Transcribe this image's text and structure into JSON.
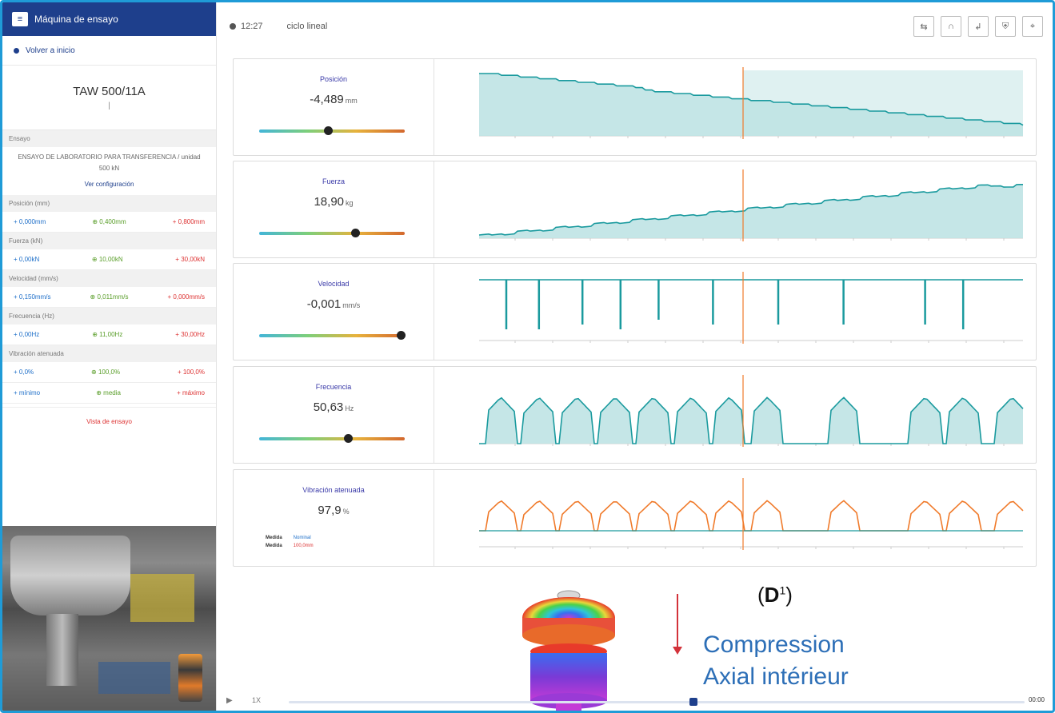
{
  "sidebar": {
    "app_title": "Máquina de ensayo",
    "back_label": "Volver a inicio",
    "machine_name": "TAW 500/11A",
    "machine_sub": "|",
    "test_section": "Ensayo",
    "test_desc": "ENSAYO DE LABORATORIO PARA TRANSFERENCIA / unidad 500 kN",
    "test_link": "Ver configuración",
    "groups": [
      {
        "head": "Posición (mm)",
        "values": [
          "+ 0,000mm",
          "⊕ 0,400mm",
          "+ 0,800mm"
        ]
      },
      {
        "head": "Fuerza (kN)",
        "values": [
          "+ 0,00kN",
          "⊕ 10,00kN",
          "+ 30,00kN"
        ]
      },
      {
        "head": "Velocidad (mm/s)",
        "values": [
          "+ 0,150mm/s",
          "⊕ 0,011mm/s",
          "+ 0,000mm/s"
        ]
      },
      {
        "head": "Frecuencia (Hz)",
        "values": [
          "+ 0,00Hz",
          "⊕ 11,00Hz",
          "+ 30,00Hz"
        ]
      },
      {
        "head": "Vibración atenuada",
        "values": [
          "+ 0,0%",
          "⊕ 100,0%",
          "+ 100,0%"
        ]
      },
      {
        "head": "",
        "values": [
          "+ mínimo",
          "⊕ media",
          "+ máximo"
        ]
      }
    ],
    "footer": "Vista de ensayo"
  },
  "topbar": {
    "time": "12:27",
    "status": "ciclo lineal",
    "tools": [
      "⇆",
      "∩",
      "↲",
      "⛨",
      "⌖"
    ]
  },
  "panels": [
    {
      "name": "Posición",
      "value": "-4,489",
      "unit": "mm",
      "knob": 0.47
    },
    {
      "name": "Fuerza",
      "value": "18,90",
      "unit": "kg",
      "knob": 0.66
    },
    {
      "name": "Velocidad",
      "value": "-0,001",
      "unit": "mm/s",
      "knob": 0.97
    },
    {
      "name": "Frecuencia",
      "value": "50,63",
      "unit": "Hz",
      "knob": 0.61
    },
    {
      "name": "Vibración atenuada",
      "value": "97,9",
      "unit": "%",
      "legend_a": "Medida",
      "legend_a_val": "Nominal",
      "legend_b": "Medida",
      "legend_b_val": "100,0mm"
    }
  ],
  "overlay": {
    "marker_label": "D",
    "marker_sup": "1",
    "line1": "Compression",
    "line2": "Axial intérieur"
  },
  "player": {
    "speed": "1X",
    "progress": 0.55,
    "end_label": "00:00"
  },
  "colors": {
    "accent": "#1e3f8c",
    "teal": "#1a9a9e",
    "teal_fill": "#bfe3e4",
    "orange": "#f07a2a",
    "frame": "#1f9bd7"
  }
}
